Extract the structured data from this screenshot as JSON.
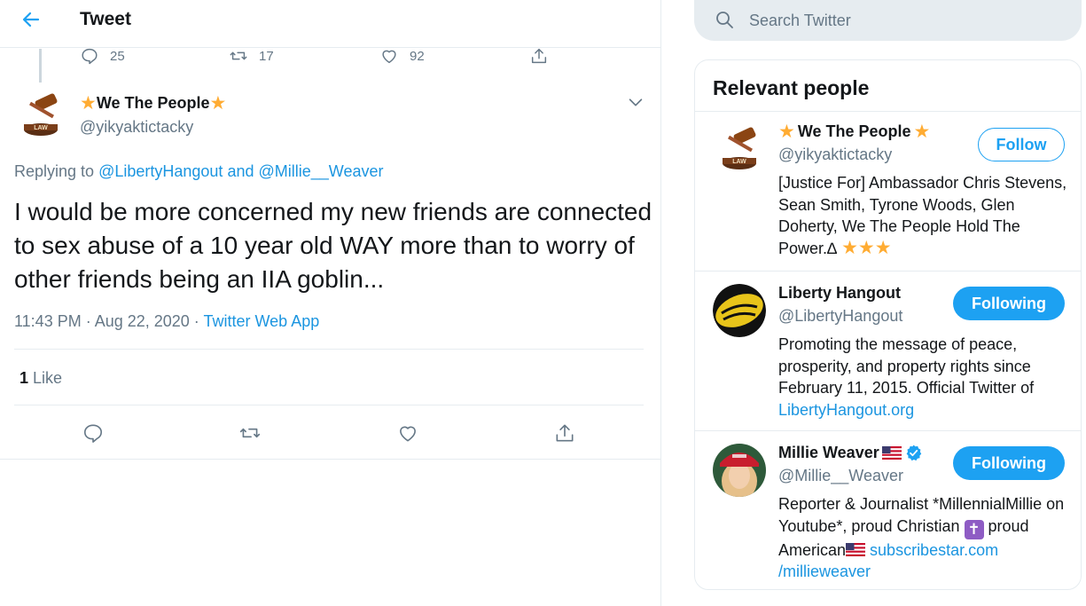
{
  "header": {
    "title": "Tweet"
  },
  "previous_tweet": {
    "replies": "25",
    "retweets": "17",
    "likes": "92"
  },
  "tweet": {
    "author": {
      "name": "We The People",
      "handle": "@yikyaktictacky"
    },
    "replying_prefix": "Replying to",
    "replying_to": [
      "@LibertyHangout",
      "@Millie__Weaver"
    ],
    "replying_and": "and",
    "text": "I would be more concerned my new friends are connected to sex abuse of a 10 year old WAY more than to worry of other friends being an IIA goblin...",
    "time": "11:43 PM · Aug 22, 2020 ·",
    "source": "Twitter Web App",
    "like_count": "1",
    "like_label": "Like"
  },
  "search": {
    "placeholder": "Search Twitter"
  },
  "sidebar": {
    "title": "Relevant people",
    "people": [
      {
        "name": "We The People",
        "handle": "@yikyaktictacky",
        "bio": "[Justice For] Ambassador Chris Stevens, Sean Smith, Tyrone Woods, Glen Doherty, We The People Hold The Power.∆",
        "button": "Follow"
      },
      {
        "name": "Liberty Hangout",
        "handle": "@LibertyHangout",
        "bio": "Promoting the message of peace, prosperity, and property rights since February 11, 2015. Official Twitter of",
        "bio_link": "LibertyHangout.org",
        "button": "Following"
      },
      {
        "name": "Millie Weaver",
        "handle": "@Millie__Weaver",
        "bio_a": "Reporter & Journalist *MillennialMillie on Youtube*, proud Christian",
        "bio_b": "proud American",
        "bio_link_a": "subscribestar.com",
        "bio_link_b": "/millieweaver",
        "button": "Following"
      }
    ]
  },
  "colors": {
    "accent": "#1da1f2",
    "link": "#1b95e0",
    "muted": "#657786",
    "border": "#e6ecf0",
    "star": "#ffac33"
  },
  "icons": [
    "back-arrow-icon",
    "reply-icon",
    "retweet-icon",
    "like-icon",
    "share-icon",
    "chevron-down-icon",
    "search-icon",
    "verified-icon",
    "us-flag-icon",
    "latin-cross-icon",
    "star-icon"
  ]
}
